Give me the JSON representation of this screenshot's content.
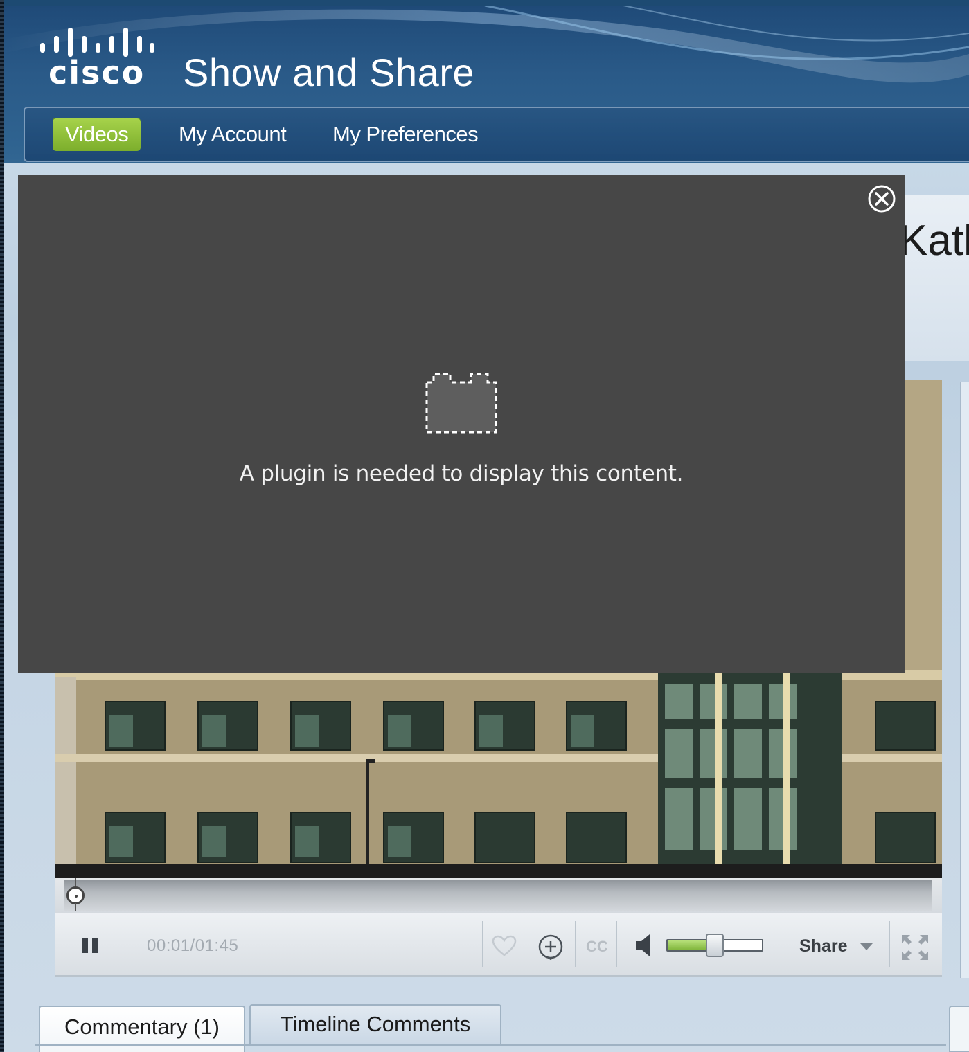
{
  "app": {
    "brand": "cisco",
    "title": "Show and Share"
  },
  "nav": {
    "tabs": [
      {
        "label": "Videos",
        "active": true
      },
      {
        "label": "My Account",
        "active": false
      },
      {
        "label": "My Preferences",
        "active": false
      }
    ]
  },
  "video": {
    "title_fragment": "Katl"
  },
  "plugin_overlay": {
    "message": "A plugin is needed to display this content.",
    "icon": "plugin-icon",
    "close_icon": "close-circle-icon"
  },
  "player": {
    "play_state_icon": "pause-icon",
    "time_display": "00:01/01:45",
    "progress_fraction": 0.01,
    "like_icon": "heart-icon",
    "add_icon": "add-circle-icon",
    "cc_label": "CC",
    "volume_icon": "speaker-icon",
    "volume_fraction": 0.5,
    "share_label": "Share",
    "share_icon": "dropdown-arrow-icon",
    "fullscreen_icon": "fullscreen-icon"
  },
  "lower_tabs": [
    {
      "label": "Commentary (1)",
      "active": true
    },
    {
      "label": "Timeline Comments",
      "active": false
    }
  ],
  "colors": {
    "active_tab_green": "#8bbd35",
    "header_blue": "#2a5a88",
    "overlay_gray": "#474747"
  }
}
